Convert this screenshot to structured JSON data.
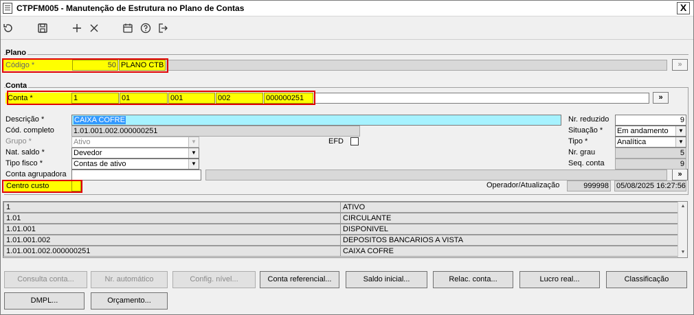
{
  "window": {
    "title": "CTPFM005 - Manutenção de Estrutura no Plano de Contas",
    "close_glyph": "X"
  },
  "toolbar": {
    "buttons": [
      {
        "icon": "refresh-icon"
      },
      {
        "icon": "save-icon"
      },
      {
        "icon": "add-icon"
      },
      {
        "icon": "delete-icon"
      },
      {
        "icon": "calendar-icon"
      },
      {
        "icon": "help-icon"
      },
      {
        "icon": "exit-icon"
      }
    ]
  },
  "plano": {
    "group_label": "Plano",
    "codigo_label": "Código *",
    "codigo_value": "50",
    "codigo_name": "PLANO CTB",
    "lookup_glyph": "»"
  },
  "conta": {
    "group_label": "Conta",
    "conta_label": "Conta *",
    "segments": [
      "1",
      "01",
      "001",
      "002",
      "000000251"
    ],
    "lookup_glyph": "»",
    "descricao_label": "Descrição *",
    "descricao_value": "CAIXA COFRE",
    "cod_completo_label": "Cód. completo",
    "cod_completo_value": "1.01.001.002.000000251",
    "grupo_label": "Grupo *",
    "grupo_value": "Ativo",
    "efd_label": "EFD",
    "nat_saldo_label": "Nat. saldo *",
    "nat_saldo_value": "Devedor",
    "tipo_fisco_label": "Tipo fisco *",
    "tipo_fisco_value": "Contas de ativo",
    "conta_agrupadora_label": "Conta agrupadora",
    "conta_agrupadora_value": "",
    "centro_custo_label": "Centro custo",
    "centro_custo_value": "",
    "nr_reduzido_label": "Nr. reduzido",
    "nr_reduzido_value": "9",
    "situacao_label": "Situação *",
    "situacao_value": "Em andamento",
    "tipo_label": "Tipo *",
    "tipo_value": "Analítica",
    "nr_grau_label": "Nr. grau",
    "nr_grau_value": "5",
    "seq_conta_label": "Seq. conta",
    "seq_conta_value": "9",
    "operador_label": "Operador/Atualização",
    "operador_value": "999998",
    "atualizacao_value": "05/08/2025 16:27:56"
  },
  "tree": {
    "rows": [
      {
        "code": "1",
        "name": "ATIVO"
      },
      {
        "code": "1.01",
        "name": "CIRCULANTE"
      },
      {
        "code": "1.01.001",
        "name": "DISPONIVEL"
      },
      {
        "code": "1.01.001.002",
        "name": "DEPOSITOS BANCARIOS A VISTA"
      },
      {
        "code": "1.01.001.002.000000251",
        "name": "CAIXA COFRE"
      }
    ]
  },
  "buttons": {
    "consulta_conta": "Consulta conta...",
    "nr_automatico": "Nr. automático",
    "config_nivel": "Config. nível...",
    "conta_referencial": "Conta referencial...",
    "saldo_inicial": "Saldo inicial...",
    "relac_conta": "Relac. conta...",
    "lucro_real": "Lucro real...",
    "classificacao": "Classificação",
    "dmpl": "DMPL...",
    "orcamento": "Orçamento..."
  },
  "colors": {
    "highlight_required": "#ffff00",
    "selected_field": "#a6f2ff",
    "annotation_box": "#e00000"
  }
}
